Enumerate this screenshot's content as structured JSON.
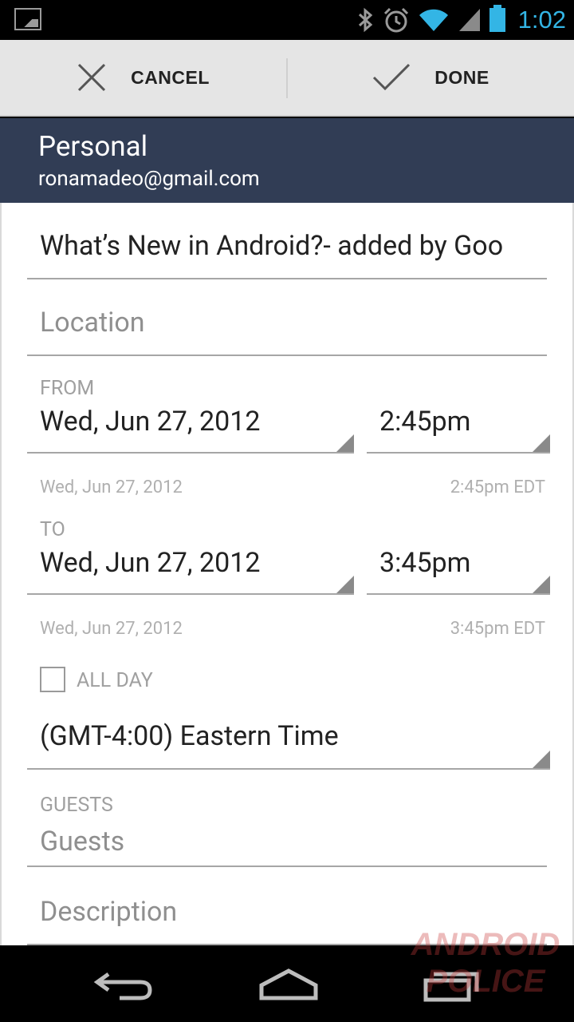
{
  "status_bar": {
    "time": "1:02",
    "icons": [
      "gallery-icon",
      "bluetooth-icon",
      "alarm-icon",
      "wifi-icon",
      "signal-icon",
      "battery-icon"
    ],
    "accent": "#33b5e5"
  },
  "action_bar": {
    "cancel_label": "CANCEL",
    "done_label": "DONE"
  },
  "account": {
    "name": "Personal",
    "email": "ronamadeo@gmail.com",
    "bg_color": "#313d55"
  },
  "form": {
    "title_value": "What’s New in Android?- added by Goo",
    "location_placeholder": "Location",
    "from_label": "FROM",
    "from_date": "Wed, Jun 27, 2012",
    "from_time": "2:45pm",
    "from_sub_date": "Wed, Jun 27, 2012",
    "from_sub_time": "2:45pm EDT",
    "to_label": "TO",
    "to_date": "Wed, Jun 27, 2012",
    "to_time": "3:45pm",
    "to_sub_date": "Wed, Jun 27, 2012",
    "to_sub_time": "3:45pm EDT",
    "all_day_label": "ALL DAY",
    "timezone": "(GMT-4:00) Eastern Time",
    "guests_label": "GUESTS",
    "guests_placeholder": "Guests",
    "description_placeholder": "Description"
  },
  "nav_bar": {
    "buttons": [
      "back-icon",
      "home-icon",
      "recent-apps-icon"
    ]
  },
  "watermark": {
    "line1": "ANDROID",
    "line2": "POLICE"
  }
}
